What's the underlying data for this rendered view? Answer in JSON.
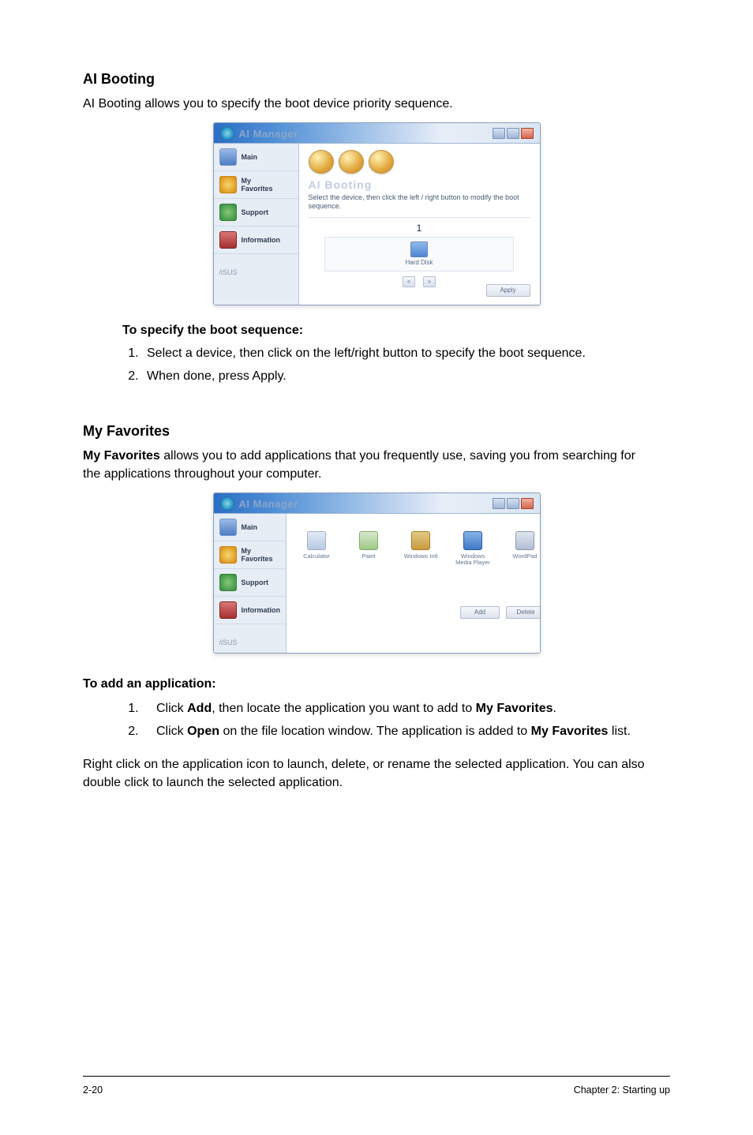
{
  "section1": {
    "heading": "AI Booting",
    "intro": "AI Booting allows you to specify the boot device priority sequence.",
    "subheading": "To specify the boot sequence:",
    "steps": [
      "Select a device, then click on the left/right button to specify the boot sequence.",
      "When done, press Apply."
    ]
  },
  "section2": {
    "heading": "My Favorites",
    "intro_lead": "My Favorites",
    "intro_rest": " allows you to add applications that you frequently use, saving you from searching for the applications throughout your computer.",
    "subheading": "To add an application:",
    "steps": [
      {
        "pre": "Click ",
        "bold1": "Add",
        "mid": ", then locate the application you want to add to ",
        "bold2": "My Favorites",
        "post": "."
      },
      {
        "pre": "Click ",
        "bold1": "Open",
        "mid": " on the file location window. The application is added to ",
        "bold2": "My Favorites",
        "post": " list."
      }
    ],
    "closing": "Right click on the application icon to launch, delete, or rename the selected application. You can also double click to launch the selected application."
  },
  "window1": {
    "title": "AI Manager",
    "sidebar": {
      "main": "Main",
      "favorites_line1": "My",
      "favorites_line2": "Favorites",
      "support": "Support",
      "information": "Information",
      "brand": "/iSUS"
    },
    "main": {
      "section": "AI Booting",
      "desc": "Select the device, then click the left / right button to modify the boot sequence.",
      "boot_num": "1",
      "boot_label": "Hard Disk",
      "arrow_left": "«",
      "arrow_right": "»",
      "apply": "Apply"
    }
  },
  "window2": {
    "title": "AI Manager",
    "sidebar": {
      "main": "Main",
      "favorites": "My Favorites",
      "support": "Support",
      "information": "Information",
      "brand": "/iSUS"
    },
    "main": {
      "items": [
        {
          "label": "Calculator"
        },
        {
          "label": "Paint"
        },
        {
          "label": "Windows Intl"
        },
        {
          "label": "Windows Media Player"
        },
        {
          "label": "WordPad"
        }
      ],
      "add": "Add",
      "delete": "Delete"
    }
  },
  "footer": {
    "left": "2-20",
    "right": "Chapter 2: Starting up"
  }
}
